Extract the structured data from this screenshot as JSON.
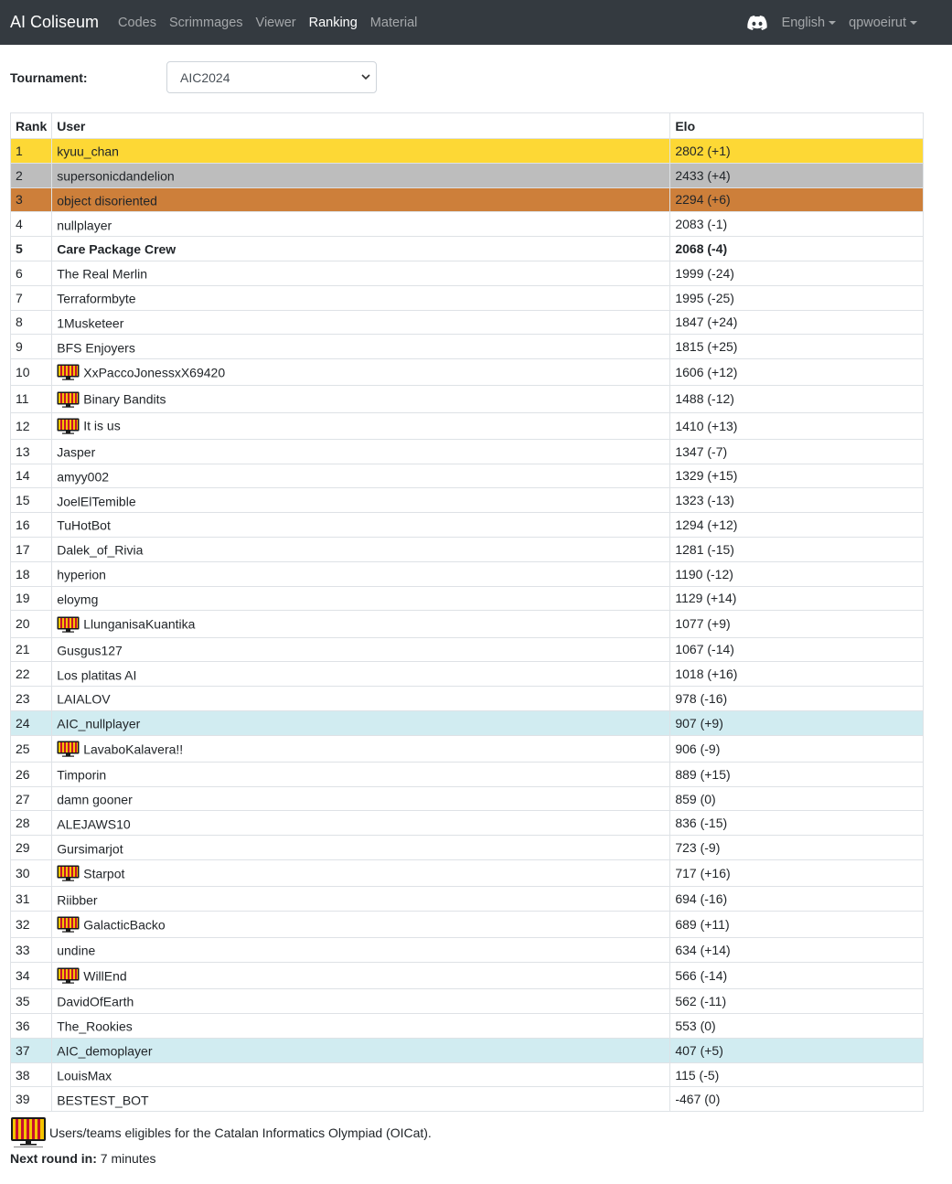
{
  "nav": {
    "brand": "AI Coliseum",
    "links": [
      "Codes",
      "Scrimmages",
      "Viewer",
      "Ranking",
      "Material"
    ],
    "active": "Ranking",
    "language": "English",
    "user": "qpwoeirut",
    "icons": [
      "discord-icon"
    ]
  },
  "tournament": {
    "label": "Tournament:",
    "selected": "AIC2024"
  },
  "table": {
    "headers": [
      "Rank",
      "User",
      "Elo"
    ],
    "rows": [
      {
        "rank": "1",
        "user": "kyuu_chan",
        "elo": "2802 (+1)",
        "style": "gold",
        "oicat": false
      },
      {
        "rank": "2",
        "user": "supersonicdandelion",
        "elo": "2433 (+4)",
        "style": "silver",
        "oicat": false
      },
      {
        "rank": "3",
        "user": "object disoriented",
        "elo": "2294 (+6)",
        "style": "bronze",
        "oicat": false
      },
      {
        "rank": "4",
        "user": "nullplayer",
        "elo": "2083 (-1)",
        "style": "",
        "oicat": false
      },
      {
        "rank": "5",
        "user": "Care Package Crew",
        "elo": "2068 (-4)",
        "style": "mine",
        "oicat": false
      },
      {
        "rank": "6",
        "user": "The Real Merlin",
        "elo": "1999 (-24)",
        "style": "",
        "oicat": false
      },
      {
        "rank": "7",
        "user": "Terraformbyte",
        "elo": "1995 (-25)",
        "style": "",
        "oicat": false
      },
      {
        "rank": "8",
        "user": "1Musketeer",
        "elo": "1847 (+24)",
        "style": "",
        "oicat": false
      },
      {
        "rank": "9",
        "user": "BFS Enjoyers",
        "elo": "1815 (+25)",
        "style": "",
        "oicat": false
      },
      {
        "rank": "10",
        "user": "XxPaccoJonessxX69420",
        "elo": "1606 (+12)",
        "style": "",
        "oicat": true
      },
      {
        "rank": "11",
        "user": "Binary Bandits",
        "elo": "1488 (-12)",
        "style": "",
        "oicat": true
      },
      {
        "rank": "12",
        "user": "It is us",
        "elo": "1410 (+13)",
        "style": "",
        "oicat": true
      },
      {
        "rank": "13",
        "user": "Jasper",
        "elo": "1347 (-7)",
        "style": "",
        "oicat": false
      },
      {
        "rank": "14",
        "user": "amyy002",
        "elo": "1329 (+15)",
        "style": "",
        "oicat": false
      },
      {
        "rank": "15",
        "user": "JoelElTemible",
        "elo": "1323 (-13)",
        "style": "",
        "oicat": false
      },
      {
        "rank": "16",
        "user": "TuHotBot",
        "elo": "1294 (+12)",
        "style": "",
        "oicat": false
      },
      {
        "rank": "17",
        "user": "Dalek_of_Rivia",
        "elo": "1281 (-15)",
        "style": "",
        "oicat": false
      },
      {
        "rank": "18",
        "user": "hyperion",
        "elo": "1190 (-12)",
        "style": "",
        "oicat": false
      },
      {
        "rank": "19",
        "user": "eloymg",
        "elo": "1129 (+14)",
        "style": "",
        "oicat": false
      },
      {
        "rank": "20",
        "user": "LlunganisaKuantika",
        "elo": "1077 (+9)",
        "style": "",
        "oicat": true
      },
      {
        "rank": "21",
        "user": "Gusgus127",
        "elo": "1067 (-14)",
        "style": "",
        "oicat": false
      },
      {
        "rank": "22",
        "user": "Los platitas AI",
        "elo": "1018 (+16)",
        "style": "",
        "oicat": false
      },
      {
        "rank": "23",
        "user": "LAIALOV",
        "elo": "978 (-16)",
        "style": "",
        "oicat": false
      },
      {
        "rank": "24",
        "user": "AIC_nullplayer",
        "elo": "907 (+9)",
        "style": "demo",
        "oicat": false
      },
      {
        "rank": "25",
        "user": "LavaboKalavera!!",
        "elo": "906 (-9)",
        "style": "",
        "oicat": true
      },
      {
        "rank": "26",
        "user": "Timporin",
        "elo": "889 (+15)",
        "style": "",
        "oicat": false
      },
      {
        "rank": "27",
        "user": "damn gooner",
        "elo": "859 (0)",
        "style": "",
        "oicat": false
      },
      {
        "rank": "28",
        "user": "ALEJAWS10",
        "elo": "836 (-15)",
        "style": "",
        "oicat": false
      },
      {
        "rank": "29",
        "user": "Gursimarjot",
        "elo": "723 (-9)",
        "style": "",
        "oicat": false
      },
      {
        "rank": "30",
        "user": "Starpot",
        "elo": "717 (+16)",
        "style": "",
        "oicat": true
      },
      {
        "rank": "31",
        "user": "Riibber",
        "elo": "694 (-16)",
        "style": "",
        "oicat": false
      },
      {
        "rank": "32",
        "user": "GalacticBacko",
        "elo": "689 (+11)",
        "style": "",
        "oicat": true
      },
      {
        "rank": "33",
        "user": "undine",
        "elo": "634 (+14)",
        "style": "",
        "oicat": false
      },
      {
        "rank": "34",
        "user": "WillEnd",
        "elo": "566 (-14)",
        "style": "",
        "oicat": true
      },
      {
        "rank": "35",
        "user": "DavidOfEarth",
        "elo": "562 (-11)",
        "style": "",
        "oicat": false
      },
      {
        "rank": "36",
        "user": "The_Rookies",
        "elo": "553 (0)",
        "style": "",
        "oicat": false
      },
      {
        "rank": "37",
        "user": "AIC_demoplayer",
        "elo": "407 (+5)",
        "style": "demo",
        "oicat": false
      },
      {
        "rank": "38",
        "user": "LouisMax",
        "elo": "115 (-5)",
        "style": "",
        "oicat": false
      },
      {
        "rank": "39",
        "user": "BESTEST_BOT",
        "elo": "-467 (0)",
        "style": "",
        "oicat": false
      }
    ]
  },
  "legend": {
    "text": "Users/teams eligibles for the Catalan Informatics Olympiad (OICat).",
    "icon": "oicat-logo-icon"
  },
  "next_round": {
    "label": "Next round in:",
    "value": " 7 minutes"
  },
  "colors": {
    "navbar": "#343a40",
    "gold": "#fdd835",
    "silver": "#bdbdbd",
    "bronze": "#cd7f3a",
    "demo": "#d1ecf1"
  }
}
